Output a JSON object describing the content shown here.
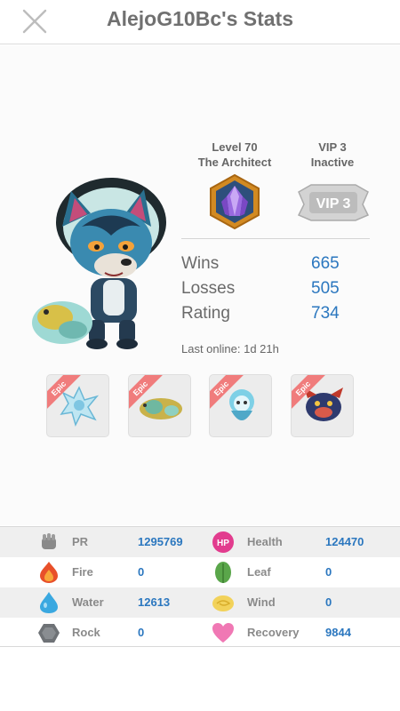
{
  "header": {
    "title": "AlejoG10Bc's Stats"
  },
  "profile": {
    "level_line1": "Level 70",
    "level_line2": "The Architect",
    "vip_line1": "VIP 3",
    "vip_line2": "Inactive",
    "vip_badge_text": "VIP 3",
    "records": [
      {
        "label": "Wins",
        "value": "665"
      },
      {
        "label": "Losses",
        "value": "505"
      },
      {
        "label": "Rating",
        "value": "734"
      }
    ],
    "last_online": "Last online: 1d 21h"
  },
  "team": [
    {
      "tag": "Epic",
      "icon": "ice-wolf-monster-icon"
    },
    {
      "tag": "Epic",
      "icon": "gold-dragon-monster-icon"
    },
    {
      "tag": "Epic",
      "icon": "water-spirit-monster-icon"
    },
    {
      "tag": "Epic",
      "icon": "dark-beast-monster-icon"
    }
  ],
  "stats": [
    {
      "left_label": "PR",
      "left_value": "1295769",
      "left_icon": "power-fist-icon",
      "right_label": "Health",
      "right_value": "124470",
      "right_icon": "hp-icon"
    },
    {
      "left_label": "Fire",
      "left_value": "0",
      "left_icon": "fire-icon",
      "right_label": "Leaf",
      "right_value": "0",
      "right_icon": "leaf-icon"
    },
    {
      "left_label": "Water",
      "left_value": "12613",
      "left_icon": "water-drop-icon",
      "right_label": "Wind",
      "right_value": "0",
      "right_icon": "wind-icon"
    },
    {
      "left_label": "Rock",
      "left_value": "0",
      "left_icon": "rock-icon",
      "right_label": "Recovery",
      "right_value": "9844",
      "right_icon": "heart-icon"
    }
  ],
  "colors": {
    "accent": "#2b77bf",
    "ribbon": "#f07c7c",
    "label": "#8a8a8a"
  }
}
